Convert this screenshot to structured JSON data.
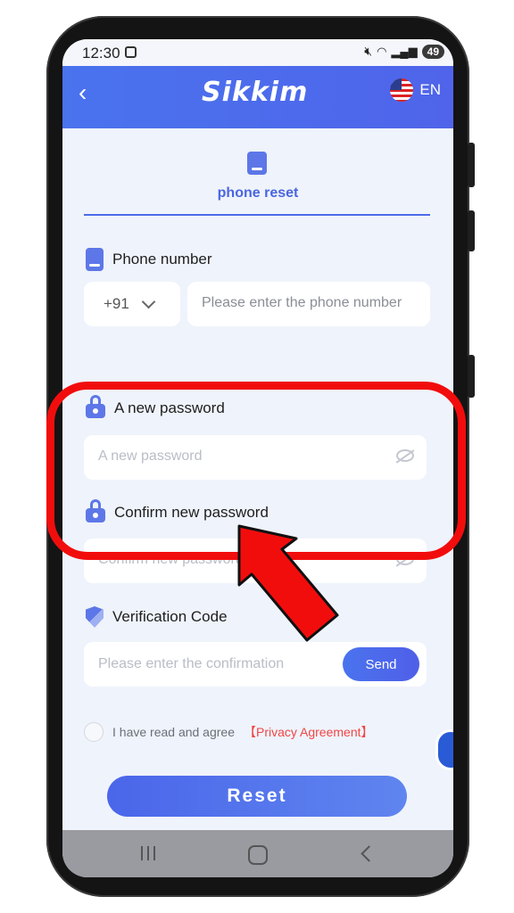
{
  "status_bar": {
    "time": "12:30",
    "battery": "49",
    "icons": [
      "screenshot-icon",
      "mute-icon",
      "wifi-icon",
      "signal-icon",
      "battery-icon"
    ]
  },
  "header": {
    "back_icon": "chevron-left-icon",
    "logo_text": "Sikkim",
    "language": "EN",
    "flag_icon": "us-flag-icon"
  },
  "tab": {
    "label": "phone reset",
    "icon": "phone-icon"
  },
  "form": {
    "phone": {
      "label": "Phone number",
      "country_code": "+91",
      "placeholder": "Please enter the phone number"
    },
    "new_password": {
      "label": "A new password",
      "placeholder": "A new password"
    },
    "confirm_password": {
      "label": "Confirm new password",
      "placeholder": "Confirm new password"
    },
    "verification": {
      "label": "Verification Code",
      "placeholder": "Please enter the confirmation",
      "send_label": "Send"
    },
    "agreement": {
      "text": "I have read and agree",
      "link": "【Privacy Agreement】"
    },
    "reset_label": "Reset"
  },
  "colors": {
    "accent": "#4e6be8",
    "annotation": "#f20d0d",
    "privacy_link": "#f04646"
  }
}
